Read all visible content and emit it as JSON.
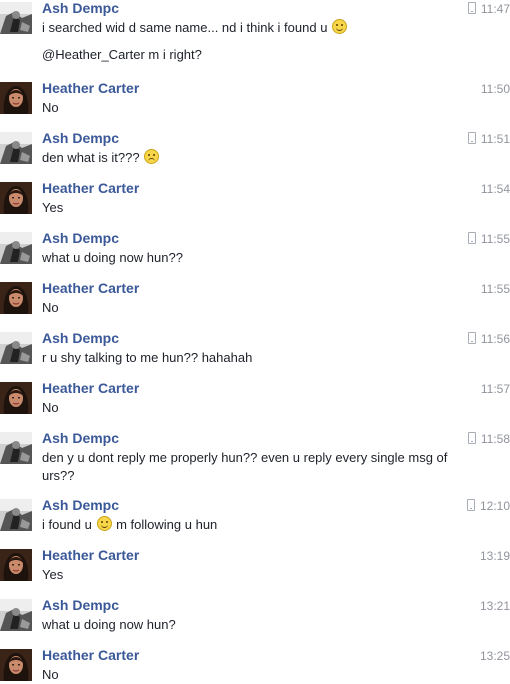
{
  "conversation": [
    {
      "sender": "Ash Dempc",
      "avatar": "ash",
      "time": "11:47",
      "mobile": true,
      "lines": [
        [
          "i searched wid d same name... nd i think i found u ",
          "smile",
          ""
        ],
        [
          "@Heather_Carter m i right?"
        ]
      ]
    },
    {
      "sender": "Heather Carter",
      "avatar": "heather",
      "time": "11:50",
      "mobile": false,
      "lines": [
        [
          "No"
        ]
      ]
    },
    {
      "sender": "Ash Dempc",
      "avatar": "ash",
      "time": "11:51",
      "mobile": true,
      "lines": [
        [
          "den what is it??? ",
          "frown",
          ""
        ]
      ]
    },
    {
      "sender": "Heather Carter",
      "avatar": "heather",
      "time": "11:54",
      "mobile": false,
      "lines": [
        [
          "Yes"
        ]
      ]
    },
    {
      "sender": "Ash Dempc",
      "avatar": "ash",
      "time": "11:55",
      "mobile": true,
      "lines": [
        [
          "what u doing now hun??"
        ]
      ]
    },
    {
      "sender": "Heather Carter",
      "avatar": "heather",
      "time": "11:55",
      "mobile": false,
      "lines": [
        [
          "No"
        ]
      ]
    },
    {
      "sender": "Ash Dempc",
      "avatar": "ash",
      "time": "11:56",
      "mobile": true,
      "lines": [
        [
          "r u shy talking to me hun?? hahahah"
        ]
      ]
    },
    {
      "sender": "Heather Carter",
      "avatar": "heather",
      "time": "11:57",
      "mobile": false,
      "lines": [
        [
          "No"
        ]
      ]
    },
    {
      "sender": "Ash Dempc",
      "avatar": "ash",
      "time": "11:58",
      "mobile": true,
      "lines": [
        [
          "den y u dont reply me properly hun?? even u reply every single msg of urs??"
        ]
      ]
    },
    {
      "sender": "Ash Dempc",
      "avatar": "ash",
      "time": "12:10",
      "mobile": true,
      "lines": [
        [
          "i found u ",
          "smile",
          " m following u hun"
        ]
      ]
    },
    {
      "sender": "Heather Carter",
      "avatar": "heather",
      "time": "13:19",
      "mobile": false,
      "lines": [
        [
          "Yes"
        ]
      ]
    },
    {
      "sender": "Ash Dempc",
      "avatar": "ash",
      "time": "13:21",
      "mobile": false,
      "lines": [
        [
          "what u doing now hun?"
        ]
      ]
    },
    {
      "sender": "Heather Carter",
      "avatar": "heather",
      "time": "13:25",
      "mobile": false,
      "lines": [
        [
          "No"
        ]
      ]
    }
  ]
}
